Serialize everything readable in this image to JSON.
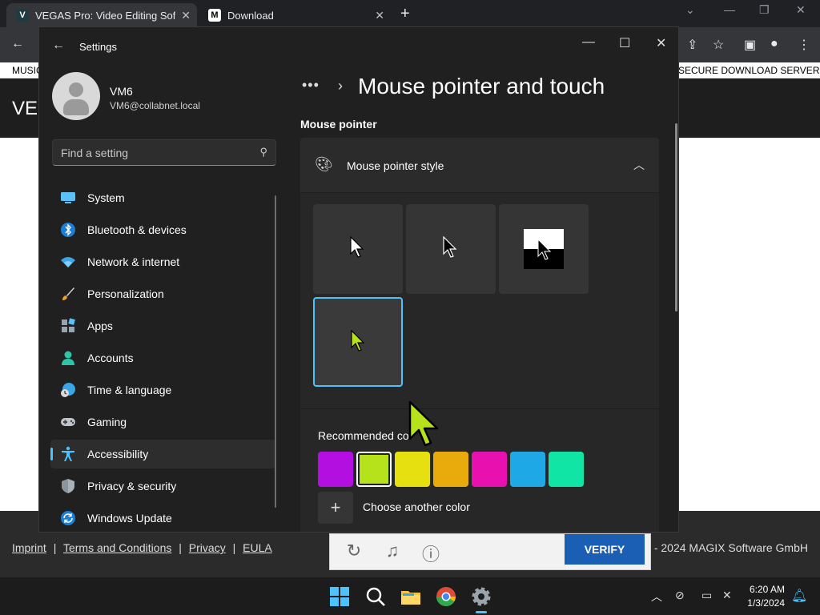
{
  "browser": {
    "tabs": [
      {
        "title": "VEGAS Pro: Video Editing Softwa",
        "favicon": "V"
      },
      {
        "title": "Download",
        "favicon": "M"
      }
    ],
    "new_tab": "+"
  },
  "webpage": {
    "topbar_left": "MUSIC",
    "topbar_right": "SECURE DOWNLOAD SERVER",
    "header_logo": "VEG",
    "footer_links": [
      "Imprint",
      "Terms and Conditions",
      "Privacy",
      "EULA"
    ],
    "footer_separator": "|",
    "copyright": "3 - 2024 MAGIX Software GmbH",
    "verify_label": "VERIFY"
  },
  "settings": {
    "app_title": "Settings",
    "user": {
      "name": "VM6",
      "email": "VM6@collabnet.local"
    },
    "search_placeholder": "Find a setting",
    "nav": [
      {
        "label": "System",
        "icon": "monitor-icon"
      },
      {
        "label": "Bluetooth & devices",
        "icon": "bluetooth-icon"
      },
      {
        "label": "Network & internet",
        "icon": "wifi-icon"
      },
      {
        "label": "Personalization",
        "icon": "brush-icon"
      },
      {
        "label": "Apps",
        "icon": "apps-icon"
      },
      {
        "label": "Accounts",
        "icon": "person-icon"
      },
      {
        "label": "Time & language",
        "icon": "globe-clock-icon"
      },
      {
        "label": "Gaming",
        "icon": "gamepad-icon"
      },
      {
        "label": "Accessibility",
        "icon": "accessibility-icon",
        "selected": true
      },
      {
        "label": "Privacy & security",
        "icon": "shield-icon"
      },
      {
        "label": "Windows Update",
        "icon": "update-icon"
      }
    ],
    "breadcrumb_more": "•••",
    "breadcrumb_sep": "›",
    "page_title": "Mouse pointer and touch",
    "section_title": "Mouse pointer",
    "panel_label": "Mouse pointer style",
    "recommended_label": "Recommended co",
    "swatches": [
      "#b20fe0",
      "#b6e21c",
      "#e6e010",
      "#e9aa0b",
      "#e910b0",
      "#1fa8e6",
      "#10e5a6"
    ],
    "selected_swatch": 1,
    "add_color_label": "Choose another color",
    "add_color_symbol": "+"
  },
  "taskbar": {
    "time": "6:20 AM",
    "date": "1/3/2024"
  },
  "colors": {
    "accent": "#4cc2ff",
    "custom_pointer": "#b6e21c"
  }
}
